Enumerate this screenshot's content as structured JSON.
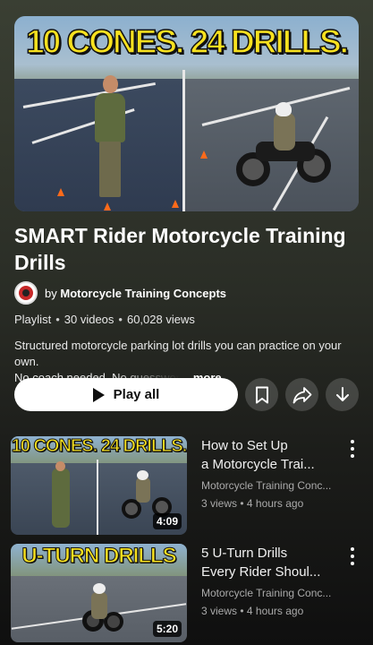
{
  "playlist": {
    "hero_thumbnail_text": "10 CONES. 24 DRILLS.",
    "title": "SMART Rider Motorcycle Training Drills",
    "channel": {
      "by": "by",
      "name": "Motorcycle Training Concepts"
    },
    "meta": {
      "type": "Playlist",
      "videos": "30 videos",
      "views": "60,028 views",
      "separator": "•"
    },
    "description": {
      "line1": "Structured motorcycle parking lot drills you can practice on your own.",
      "line2_visible": "No coach needed. No guesswor",
      "more": "...more"
    },
    "actions": {
      "play_all": "Play all"
    }
  },
  "videos": [
    {
      "thumbnail_text": "10 CONES. 24 DRILLS.",
      "title_line1": "How to Set Up",
      "title_line2": "a Motorcycle Trai...",
      "channel": "Motorcycle Training Conc...",
      "stats": "3 views • 4 hours ago",
      "duration": "4:09"
    },
    {
      "thumbnail_text": "U-TURN DRILLS",
      "title_line1": "5 U-Turn Drills",
      "title_line2": "Every Rider Shoul...",
      "channel": "Motorcycle Training Conc...",
      "stats": "3 views • 4 hours ago",
      "duration": "5:20"
    }
  ],
  "icons": {
    "save": "bookmark-icon",
    "share": "share-icon",
    "download": "download-icon",
    "more": "kebab-menu-icon",
    "play": "play-icon"
  },
  "colors": {
    "background": "#0f0f0f",
    "thumbnail_title": "#f7e11f",
    "play_button_bg": "#ffffff",
    "secondary_text": "#aaaaaa"
  }
}
